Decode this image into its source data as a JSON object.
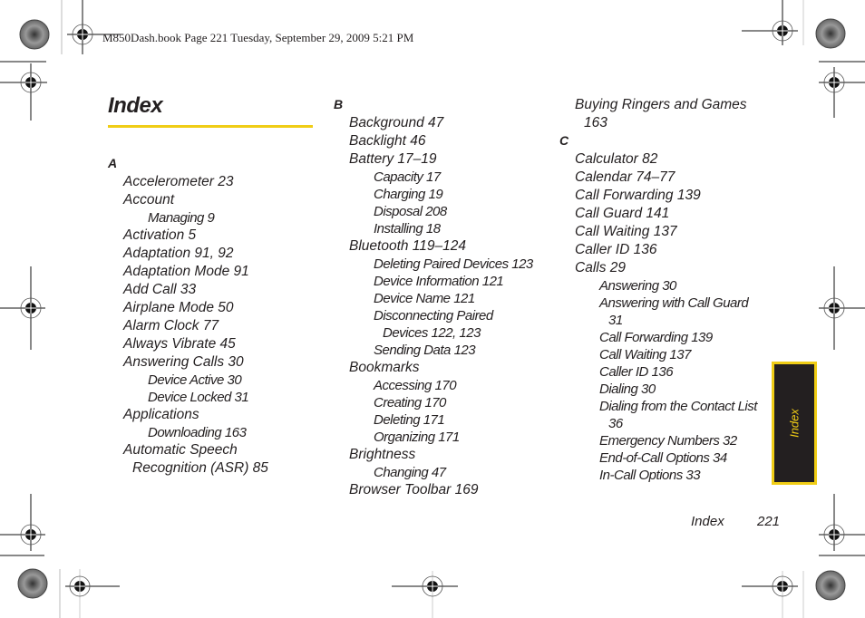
{
  "header": {
    "print_info": "M850Dash.book  Page 221  Tuesday, September 29, 2009  5:21 PM"
  },
  "page": {
    "title": "Index",
    "accent_color": "#f0cd16",
    "footer_label": "Index",
    "page_number": "221",
    "side_tab_label": "Index"
  },
  "columns": [
    {
      "entries": [
        {
          "text": "A",
          "kind": "letter"
        },
        {
          "text": "Accelerometer 23",
          "kind": "main"
        },
        {
          "text": "Account",
          "kind": "main"
        },
        {
          "text": "Managing 9",
          "kind": "sub"
        },
        {
          "text": "Activation 5",
          "kind": "main"
        },
        {
          "text": "Adaptation 91, 92",
          "kind": "main"
        },
        {
          "text": "Adaptation Mode 91",
          "kind": "main"
        },
        {
          "text": "Add Call 33",
          "kind": "main"
        },
        {
          "text": "Airplane Mode 50",
          "kind": "main"
        },
        {
          "text": "Alarm Clock 77",
          "kind": "main"
        },
        {
          "text": "Always Vibrate 45",
          "kind": "main"
        },
        {
          "text": "Answering Calls 30",
          "kind": "main"
        },
        {
          "text": "Device Active 30",
          "kind": "sub"
        },
        {
          "text": "Device Locked 31",
          "kind": "sub"
        },
        {
          "text": "Applications",
          "kind": "main"
        },
        {
          "text": "Downloading 163",
          "kind": "sub"
        },
        {
          "text": "Automatic Speech",
          "kind": "main"
        },
        {
          "text": "Recognition (ASR) 85",
          "kind": "cont"
        }
      ]
    },
    {
      "entries": [
        {
          "text": "B",
          "kind": "letter"
        },
        {
          "text": "Background 47",
          "kind": "main"
        },
        {
          "text": "Backlight 46",
          "kind": "main"
        },
        {
          "text": "Battery 17–19",
          "kind": "main"
        },
        {
          "text": "Capacity 17",
          "kind": "sub"
        },
        {
          "text": "Charging 19",
          "kind": "sub"
        },
        {
          "text": "Disposal 208",
          "kind": "sub"
        },
        {
          "text": "Installing 18",
          "kind": "sub"
        },
        {
          "text": "Bluetooth 119–124",
          "kind": "main"
        },
        {
          "text": "Deleting Paired Devices 123",
          "kind": "sub"
        },
        {
          "text": "Device Information 121",
          "kind": "sub"
        },
        {
          "text": "Device Name 121",
          "kind": "sub"
        },
        {
          "text": "Disconnecting Paired",
          "kind": "sub"
        },
        {
          "text": "Devices 122, 123",
          "kind": "subcont"
        },
        {
          "text": "Sending Data 123",
          "kind": "sub"
        },
        {
          "text": "Bookmarks",
          "kind": "main"
        },
        {
          "text": "Accessing 170",
          "kind": "sub"
        },
        {
          "text": "Creating 170",
          "kind": "sub"
        },
        {
          "text": "Deleting 171",
          "kind": "sub"
        },
        {
          "text": "Organizing 171",
          "kind": "sub"
        },
        {
          "text": "Brightness",
          "kind": "main"
        },
        {
          "text": "Changing 47",
          "kind": "sub"
        },
        {
          "text": "Browser Toolbar 169",
          "kind": "main"
        }
      ]
    },
    {
      "entries": [
        {
          "text": "Buying Ringers and Games",
          "kind": "main"
        },
        {
          "text": "163",
          "kind": "cont"
        },
        {
          "text": "C",
          "kind": "letter"
        },
        {
          "text": "Calculator 82",
          "kind": "main"
        },
        {
          "text": "Calendar 74–77",
          "kind": "main"
        },
        {
          "text": "Call Forwarding 139",
          "kind": "main"
        },
        {
          "text": "Call Guard 141",
          "kind": "main"
        },
        {
          "text": "Call Waiting 137",
          "kind": "main"
        },
        {
          "text": "Caller ID 136",
          "kind": "main"
        },
        {
          "text": "Calls 29",
          "kind": "main"
        },
        {
          "text": "Answering 30",
          "kind": "sub"
        },
        {
          "text": "Answering with Call Guard",
          "kind": "sub"
        },
        {
          "text": "31",
          "kind": "subcont"
        },
        {
          "text": "Call Forwarding 139",
          "kind": "sub"
        },
        {
          "text": "Call Waiting 137",
          "kind": "sub"
        },
        {
          "text": "Caller ID 136",
          "kind": "sub"
        },
        {
          "text": "Dialing 30",
          "kind": "sub"
        },
        {
          "text": "Dialing from the Contact List",
          "kind": "sub"
        },
        {
          "text": "36",
          "kind": "subcont"
        },
        {
          "text": "Emergency Numbers 32",
          "kind": "sub"
        },
        {
          "text": "End-of-Call Options 34",
          "kind": "sub"
        },
        {
          "text": "In-Call Options 33",
          "kind": "sub"
        }
      ]
    }
  ]
}
